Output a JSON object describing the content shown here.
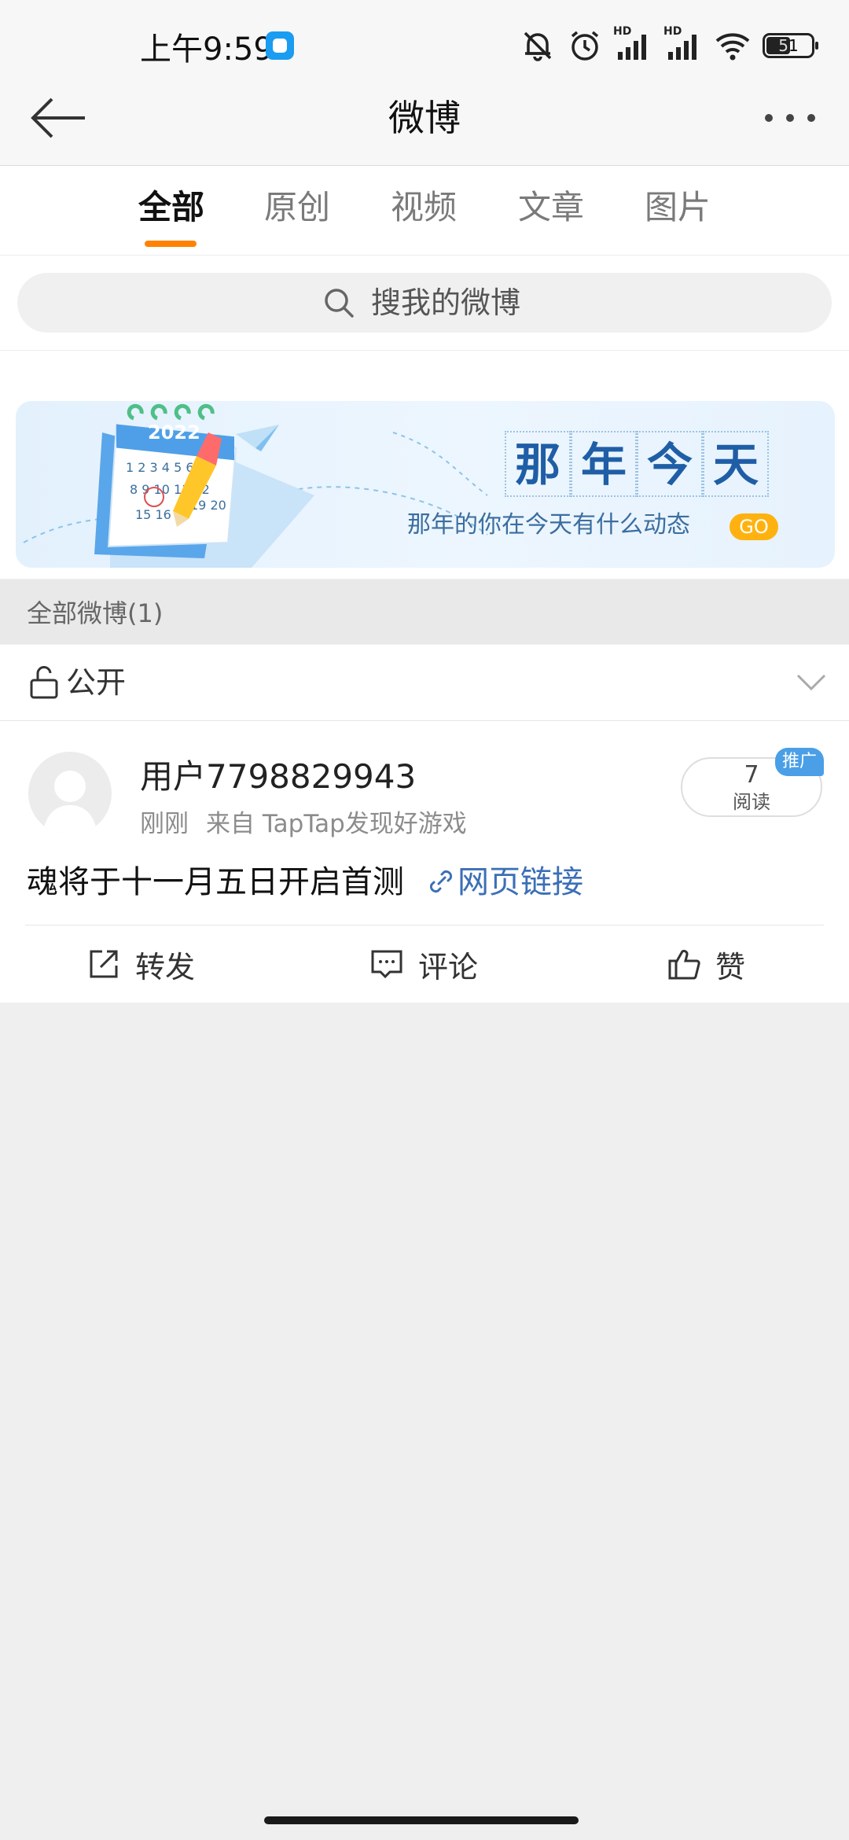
{
  "status_bar": {
    "time": "上午9:59",
    "battery": "51",
    "network_label": "HD"
  },
  "header": {
    "title": "微博"
  },
  "tabs": [
    {
      "label": "全部",
      "active": true
    },
    {
      "label": "原创",
      "active": false
    },
    {
      "label": "视频",
      "active": false
    },
    {
      "label": "文章",
      "active": false
    },
    {
      "label": "图片",
      "active": false
    }
  ],
  "search": {
    "placeholder": "搜我的微博"
  },
  "banner": {
    "chars": [
      "那",
      "年",
      "今",
      "天"
    ],
    "subtitle": "那年的你在今天有什么动态",
    "go_label": "GO",
    "calendar_year": "2022"
  },
  "section": {
    "label": "全部微博(1)"
  },
  "filter": {
    "label": "公开"
  },
  "post": {
    "username": "用户7798829943",
    "time": "刚刚",
    "source": "来自 TapTap发现好游戏",
    "read_count": "7",
    "read_label": "阅读",
    "promo_badge": "推广",
    "text": "魂将于十一月五日开启首测",
    "link_label": "网页链接",
    "actions": {
      "repost": "转发",
      "comment": "评论",
      "like": "赞"
    }
  },
  "colors": {
    "accent": "#ff8200",
    "link": "#3b6fb6",
    "promo": "#4a9fe6",
    "go": "#ffb20f"
  }
}
